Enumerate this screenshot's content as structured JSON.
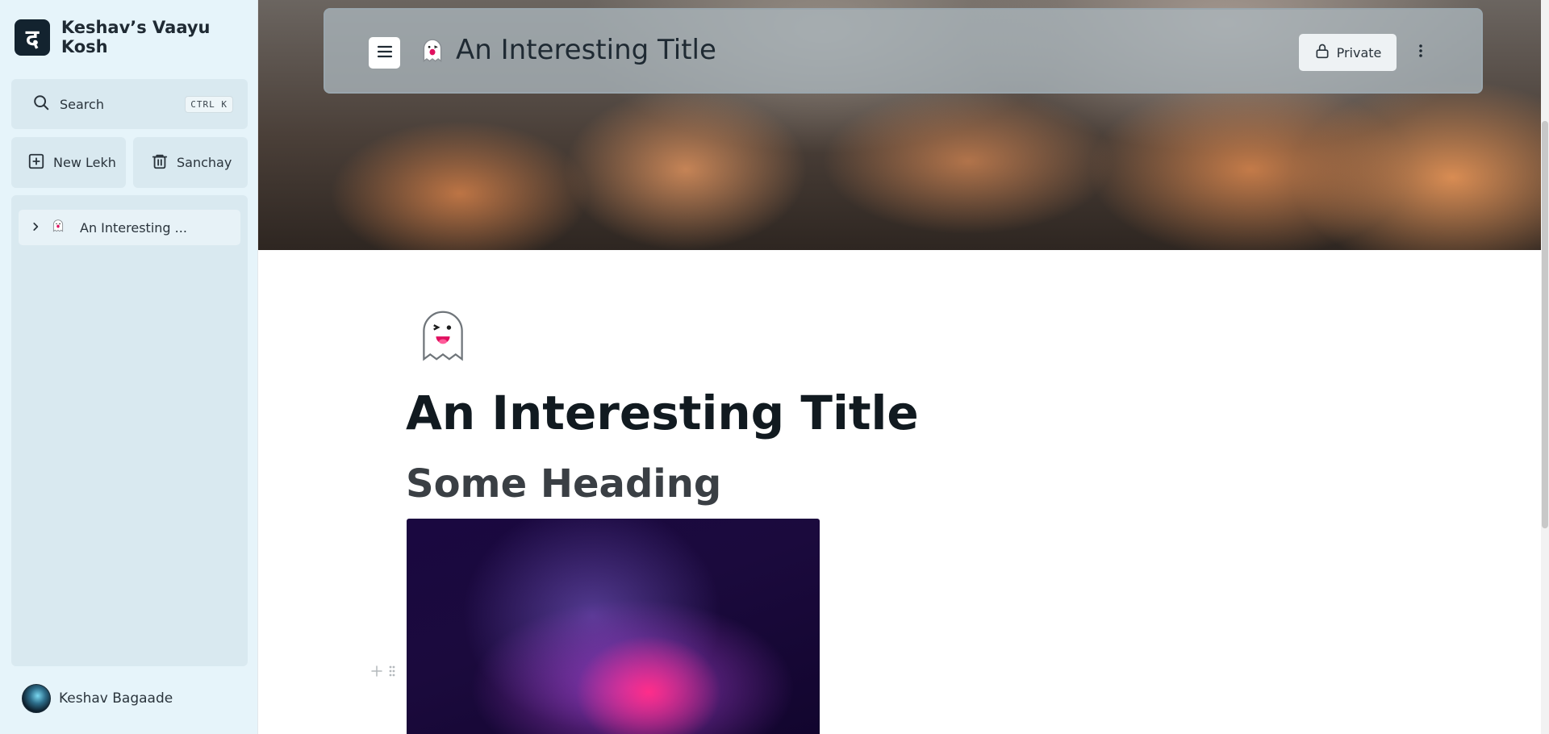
{
  "sidebar": {
    "brand": {
      "logo_glyph": "द",
      "name": "Keshav’s Vaayu Kosh"
    },
    "search": {
      "label": "Search",
      "shortcut": "CTRL K",
      "icon": "search-icon"
    },
    "actions": [
      {
        "label": "New Lekh",
        "icon": "plus-square-icon"
      },
      {
        "label": "Sanchay",
        "icon": "trash-icon"
      }
    ],
    "tree": [
      {
        "label": "An Interesting ...",
        "emoji": "ghost-icon",
        "expandable": true
      }
    ],
    "user": {
      "name": "Keshav Bagaade"
    }
  },
  "topbar": {
    "title": "An Interesting Title",
    "privacy_label": "Private"
  },
  "document": {
    "icon": "ghost-icon",
    "title": "An Interesting Title",
    "heading": "Some Heading"
  },
  "colors": {
    "sidebar_bg": "#e6f4fa",
    "sidebar_panel": "#d9e9f0",
    "brand_logo_bg": "#13232f",
    "title_text": "#111a20",
    "heading_text": "#3a3f44"
  }
}
